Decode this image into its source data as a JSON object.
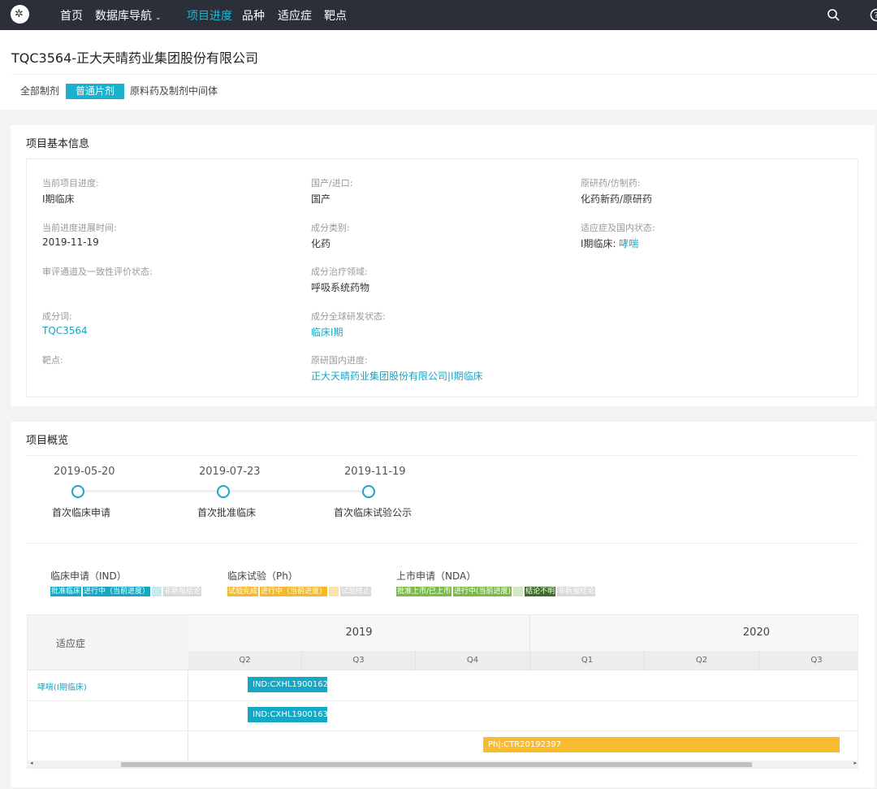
{
  "nav": {
    "items": [
      {
        "label": "首页"
      },
      {
        "label": "数据库导航"
      },
      {
        "label": "项目进度"
      },
      {
        "label": "品种"
      },
      {
        "label": "适应症"
      },
      {
        "label": "靶点"
      }
    ],
    "caret": "⌄",
    "accent": "#21b4cf"
  },
  "header": {
    "title": "TQC3564-正大天晴药业集团股份有限公司",
    "tabs": [
      {
        "label": "全部制剂"
      },
      {
        "label": "普通片剂"
      },
      {
        "label": "原料药及制剂中间体"
      }
    ]
  },
  "basic_info": {
    "title": "项目基本信息",
    "fields": [
      {
        "label": "当前项目进度:",
        "value": "I期临床"
      },
      {
        "label": "国产/进口:",
        "value": "国产"
      },
      {
        "label": "原研药/仿制药:",
        "value": "化药新药/原研药"
      },
      {
        "label": "当前进度进展时间:",
        "value": "2019-11-19"
      },
      {
        "label": "成分类别:",
        "value": "化药"
      },
      {
        "label": "适应症及国内状态:",
        "value": "I期临床:",
        "value_link": "哮喘"
      },
      {
        "label": "审评通道及一致性评价状态:",
        "value": ""
      },
      {
        "label": "成分治疗领域:",
        "value": "呼吸系统药物"
      },
      {
        "label": "成分词:",
        "value": "TQC3564"
      },
      {
        "label": "成分全球研发状态:",
        "value": "临床I期"
      },
      {
        "label": "靶点:",
        "value": ""
      },
      {
        "label": "原研国内进度:",
        "value": "正大天晴药业集团股份有限公司|I期临床"
      }
    ]
  },
  "overview": {
    "title": "项目概览",
    "timeline": [
      {
        "date": "2019-05-20",
        "label": "首次临床申请"
      },
      {
        "date": "2019-07-23",
        "label": "首次批准临床"
      },
      {
        "date": "2019-11-19",
        "label": "首次临床试验公示"
      }
    ],
    "legend": [
      {
        "title": "临床申请（IND）",
        "chips": [
          {
            "label": "批准临床",
            "color": "#14a8c4"
          },
          {
            "label": "进行中（当前进度）",
            "color": "#14a8c4"
          },
          {
            "label": "",
            "color": "#c9e9f0"
          },
          {
            "label": "非新报结论",
            "color": "#d9d9d9"
          }
        ]
      },
      {
        "title": "临床试验（Ph）",
        "chips": [
          {
            "label": "试验完成",
            "color": "#f4b92a"
          },
          {
            "label": "进行中（当前进度）",
            "color": "#f4b92a"
          },
          {
            "label": "",
            "color": "#f7e2b0"
          },
          {
            "label": "试验终止",
            "color": "#d9d9d9"
          }
        ]
      },
      {
        "title": "上市申请（NDA）",
        "chips": [
          {
            "label": "批准上市/已上市",
            "color": "#7cb94b"
          },
          {
            "label": "进行中(当前进度)",
            "color": "#7cb94b"
          },
          {
            "label": "",
            "color": "#d3e8c2"
          },
          {
            "label": "结论不明",
            "color": "#3d6b28"
          },
          {
            "label": "非新报结论",
            "color": "#d9d9d9"
          }
        ]
      }
    ],
    "gantt": {
      "header_left": "适应症",
      "years": [
        "2019",
        "2020"
      ],
      "quarters": [
        "Q2",
        "Q3",
        "Q4",
        "Q1",
        "Q2",
        "Q3"
      ],
      "rows": [
        {
          "indication": "哮喘(I期临床)",
          "bar": {
            "label": "IND:CXHL1900162",
            "color": "#14a8c4"
          }
        },
        {
          "indication": "",
          "bar": {
            "label": "IND:CXHL1900163",
            "color": "#14a8c4"
          }
        },
        {
          "indication": "",
          "bar": {
            "label": "Ph|:CTR20192397",
            "color": "#f8bd2e"
          }
        }
      ],
      "scroll_left": "◂",
      "scroll_right": "▸"
    }
  }
}
